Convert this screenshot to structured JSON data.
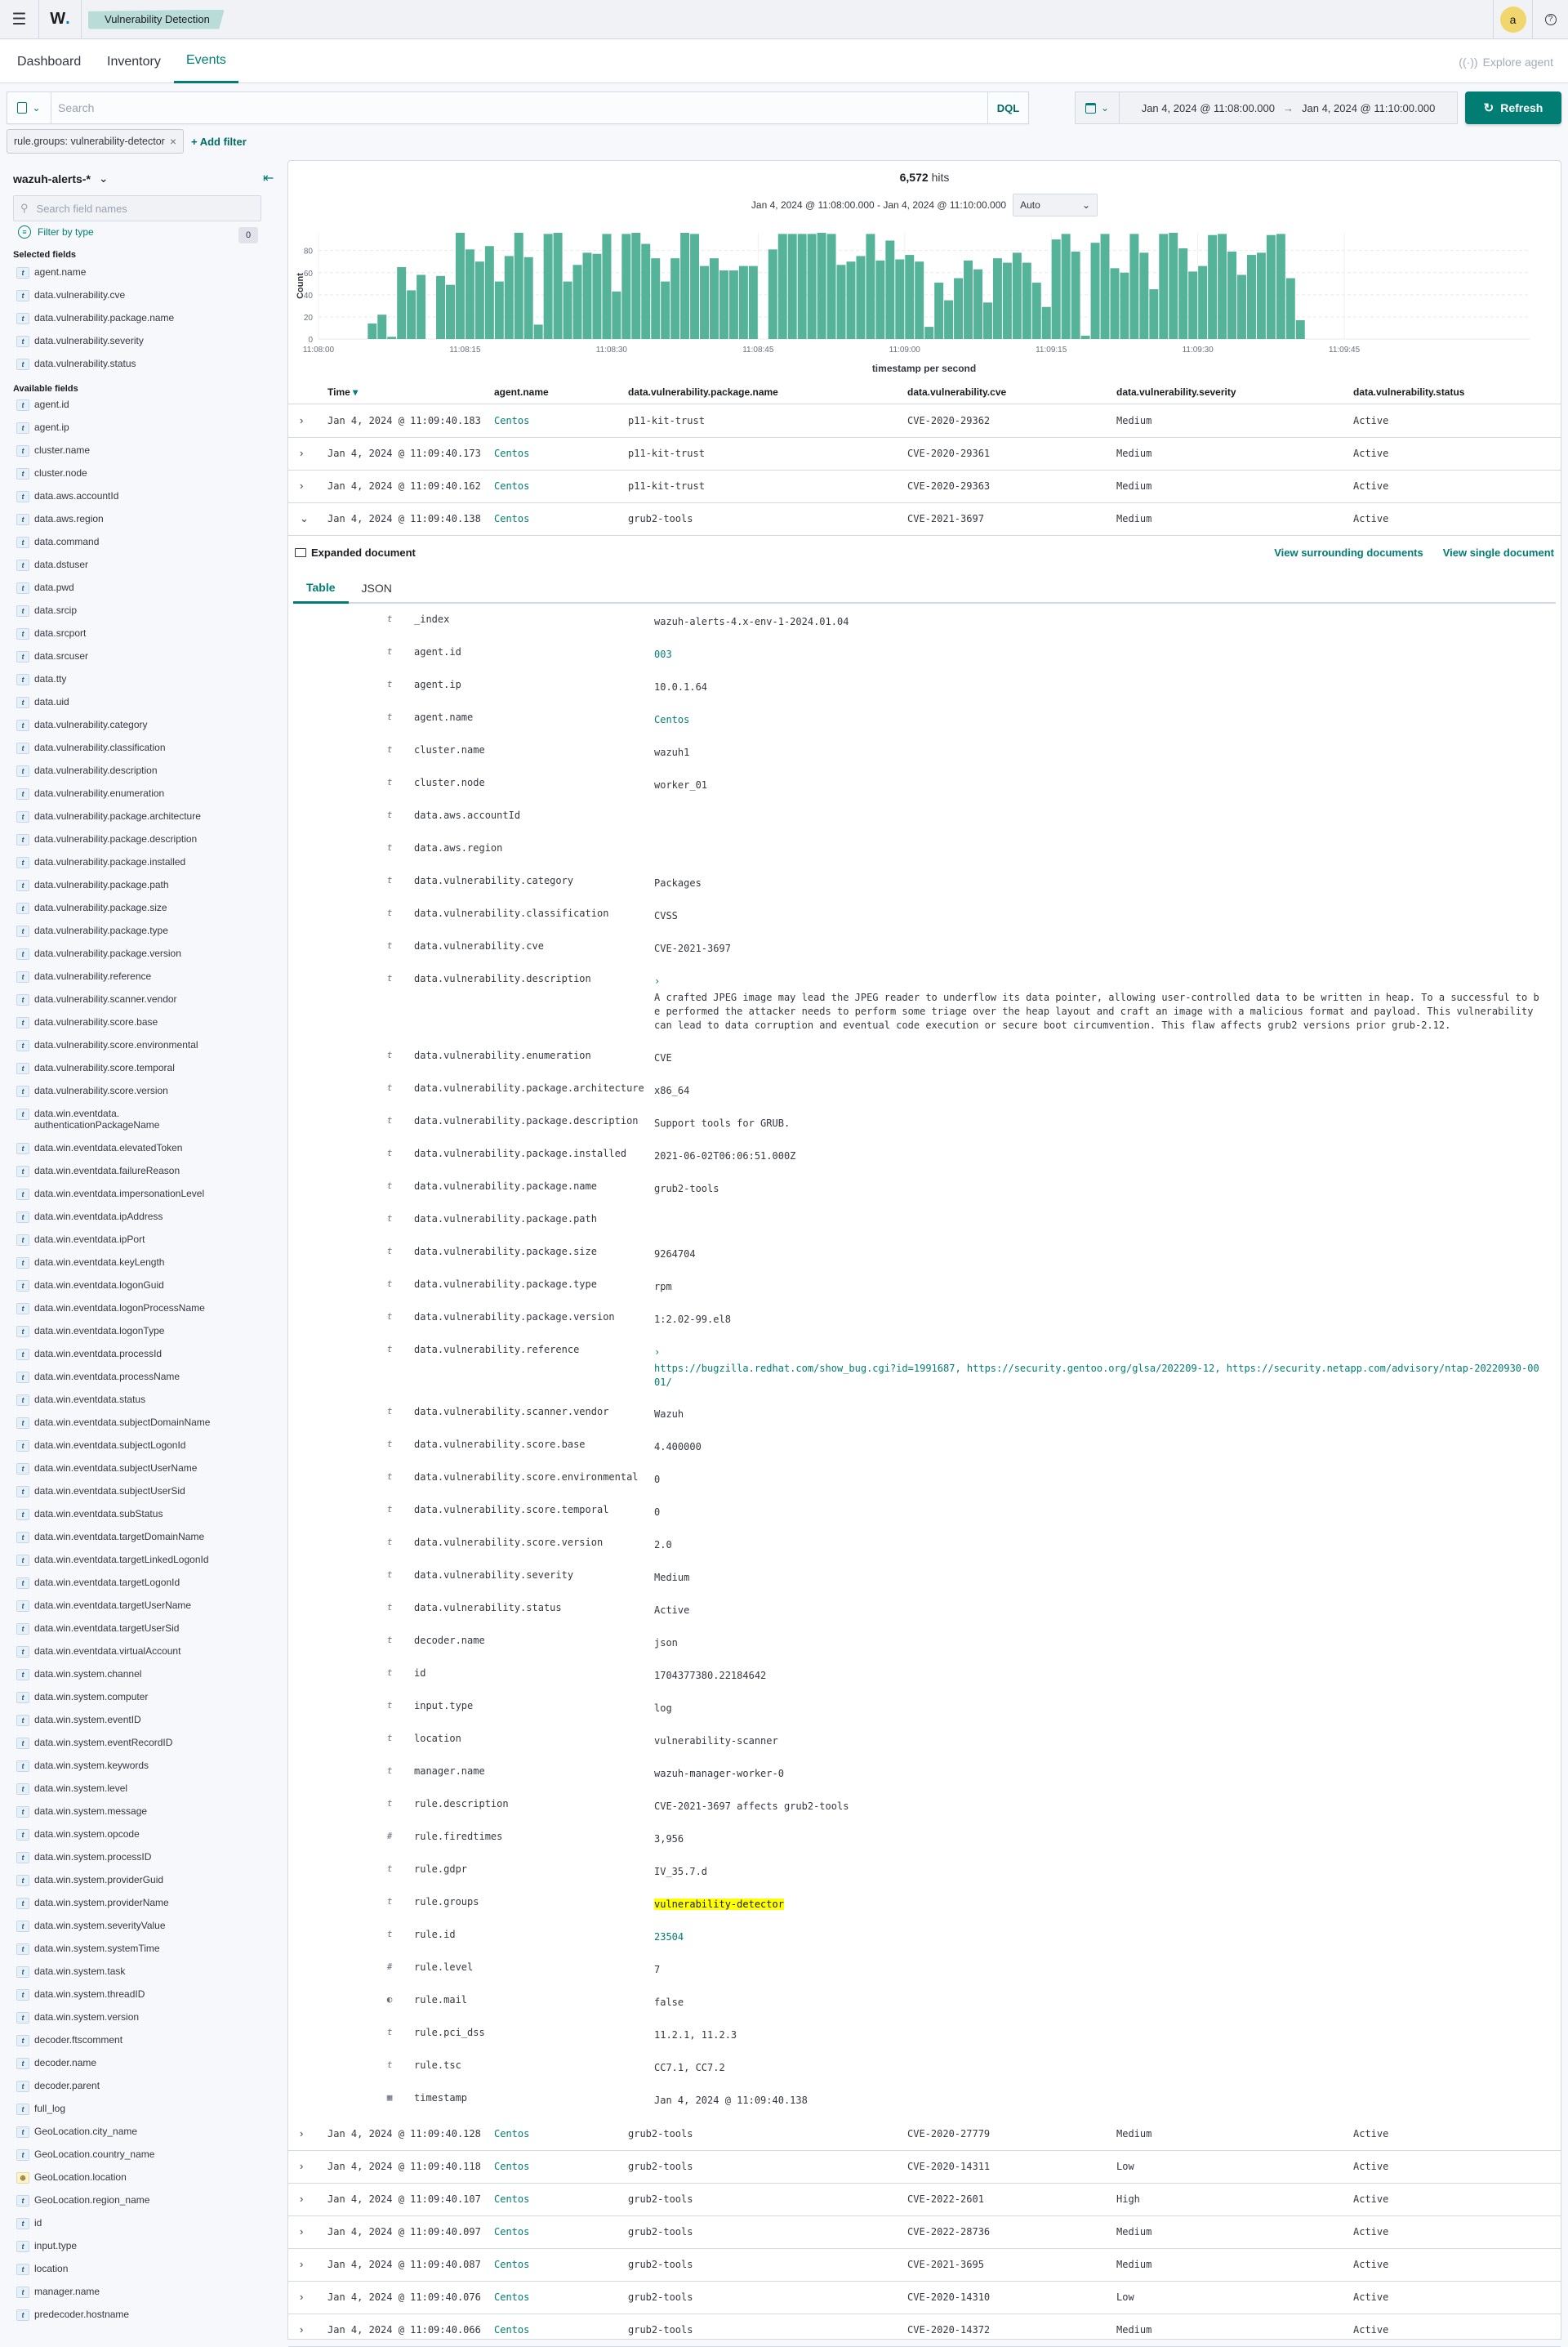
{
  "header": {
    "menu_icon": "hamburger-menu-icon",
    "logo_text": "W",
    "logo_dot": ".",
    "breadcrumb": "Vulnerability Detection",
    "avatar_initial": "a",
    "help_icon": "?"
  },
  "nav": {
    "tabs": [
      {
        "label": "Dashboard",
        "active": false
      },
      {
        "label": "Inventory",
        "active": false
      },
      {
        "label": "Events",
        "active": true
      }
    ],
    "explore_agent": "Explore agent"
  },
  "query": {
    "search_placeholder": "Search",
    "search_value": "",
    "language": "DQL",
    "date_start": "Jan 4, 2024 @ 11:08:00.000",
    "date_arrow": "→",
    "date_end": "Jan 4, 2024 @ 11:10:00.000",
    "refresh_label": "Refresh"
  },
  "filters": {
    "pills": [
      {
        "label": "rule.groups: vulnerability-detector",
        "remove": "×"
      }
    ],
    "add_filter_label": "+ Add filter"
  },
  "sidebar": {
    "index_pattern": "wazuh-alerts-*",
    "search_placeholder": "Search field names",
    "filter_by_type": "Filter by type",
    "filter_count": "0",
    "selected_header": "Selected fields",
    "selected_fields": [
      {
        "type": "t",
        "name": "agent.name"
      },
      {
        "type": "t",
        "name": "data.vulnerability.cve"
      },
      {
        "type": "t",
        "name": "data.vulnerability.package.name"
      },
      {
        "type": "t",
        "name": "data.vulnerability.severity"
      },
      {
        "type": "t",
        "name": "data.vulnerability.status"
      }
    ],
    "available_header": "Available fields",
    "available_fields": [
      {
        "type": "t",
        "name": "agent.id"
      },
      {
        "type": "t",
        "name": "agent.ip"
      },
      {
        "type": "t",
        "name": "cluster.name"
      },
      {
        "type": "t",
        "name": "cluster.node"
      },
      {
        "type": "t",
        "name": "data.aws.accountId"
      },
      {
        "type": "t",
        "name": "data.aws.region"
      },
      {
        "type": "t",
        "name": "data.command"
      },
      {
        "type": "t",
        "name": "data.dstuser"
      },
      {
        "type": "t",
        "name": "data.pwd"
      },
      {
        "type": "t",
        "name": "data.srcip"
      },
      {
        "type": "t",
        "name": "data.srcport"
      },
      {
        "type": "t",
        "name": "data.srcuser"
      },
      {
        "type": "t",
        "name": "data.tty"
      },
      {
        "type": "t",
        "name": "data.uid"
      },
      {
        "type": "t",
        "name": "data.vulnerability.category"
      },
      {
        "type": "t",
        "name": "data.vulnerability.classification"
      },
      {
        "type": "t",
        "name": "data.vulnerability.description"
      },
      {
        "type": "t",
        "name": "data.vulnerability.enumeration"
      },
      {
        "type": "t",
        "name": "data.vulnerability.package.architecture"
      },
      {
        "type": "t",
        "name": "data.vulnerability.package.description"
      },
      {
        "type": "t",
        "name": "data.vulnerability.package.installed"
      },
      {
        "type": "t",
        "name": "data.vulnerability.package.path"
      },
      {
        "type": "t",
        "name": "data.vulnerability.package.size"
      },
      {
        "type": "t",
        "name": "data.vulnerability.package.type"
      },
      {
        "type": "t",
        "name": "data.vulnerability.package.version"
      },
      {
        "type": "t",
        "name": "data.vulnerability.reference"
      },
      {
        "type": "t",
        "name": "data.vulnerability.scanner.vendor"
      },
      {
        "type": "t",
        "name": "data.vulnerability.score.base"
      },
      {
        "type": "t",
        "name": "data.vulnerability.score.environmental"
      },
      {
        "type": "t",
        "name": "data.vulnerability.score.temporal"
      },
      {
        "type": "t",
        "name": "data.vulnerability.score.version"
      },
      {
        "type": "t",
        "name": "data.win.eventdata.\nauthenticationPackageName"
      },
      {
        "type": "t",
        "name": "data.win.eventdata.elevatedToken"
      },
      {
        "type": "t",
        "name": "data.win.eventdata.failureReason"
      },
      {
        "type": "t",
        "name": "data.win.eventdata.impersonationLevel"
      },
      {
        "type": "t",
        "name": "data.win.eventdata.ipAddress"
      },
      {
        "type": "t",
        "name": "data.win.eventdata.ipPort"
      },
      {
        "type": "t",
        "name": "data.win.eventdata.keyLength"
      },
      {
        "type": "t",
        "name": "data.win.eventdata.logonGuid"
      },
      {
        "type": "t",
        "name": "data.win.eventdata.logonProcessName"
      },
      {
        "type": "t",
        "name": "data.win.eventdata.logonType"
      },
      {
        "type": "t",
        "name": "data.win.eventdata.processId"
      },
      {
        "type": "t",
        "name": "data.win.eventdata.processName"
      },
      {
        "type": "t",
        "name": "data.win.eventdata.status"
      },
      {
        "type": "t",
        "name": "data.win.eventdata.subjectDomainName"
      },
      {
        "type": "t",
        "name": "data.win.eventdata.subjectLogonId"
      },
      {
        "type": "t",
        "name": "data.win.eventdata.subjectUserName"
      },
      {
        "type": "t",
        "name": "data.win.eventdata.subjectUserSid"
      },
      {
        "type": "t",
        "name": "data.win.eventdata.subStatus"
      },
      {
        "type": "t",
        "name": "data.win.eventdata.targetDomainName"
      },
      {
        "type": "t",
        "name": "data.win.eventdata.targetLinkedLogonId"
      },
      {
        "type": "t",
        "name": "data.win.eventdata.targetLogonId"
      },
      {
        "type": "t",
        "name": "data.win.eventdata.targetUserName"
      },
      {
        "type": "t",
        "name": "data.win.eventdata.targetUserSid"
      },
      {
        "type": "t",
        "name": "data.win.eventdata.virtualAccount"
      },
      {
        "type": "t",
        "name": "data.win.system.channel"
      },
      {
        "type": "t",
        "name": "data.win.system.computer"
      },
      {
        "type": "t",
        "name": "data.win.system.eventID"
      },
      {
        "type": "t",
        "name": "data.win.system.eventRecordID"
      },
      {
        "type": "t",
        "name": "data.win.system.keywords"
      },
      {
        "type": "t",
        "name": "data.win.system.level"
      },
      {
        "type": "t",
        "name": "data.win.system.message"
      },
      {
        "type": "t",
        "name": "data.win.system.opcode"
      },
      {
        "type": "t",
        "name": "data.win.system.processID"
      },
      {
        "type": "t",
        "name": "data.win.system.providerGuid"
      },
      {
        "type": "t",
        "name": "data.win.system.providerName"
      },
      {
        "type": "t",
        "name": "data.win.system.severityValue"
      },
      {
        "type": "t",
        "name": "data.win.system.systemTime"
      },
      {
        "type": "t",
        "name": "data.win.system.task"
      },
      {
        "type": "t",
        "name": "data.win.system.threadID"
      },
      {
        "type": "t",
        "name": "data.win.system.version"
      },
      {
        "type": "t",
        "name": "decoder.ftscomment"
      },
      {
        "type": "t",
        "name": "decoder.name"
      },
      {
        "type": "t",
        "name": "decoder.parent"
      },
      {
        "type": "t",
        "name": "full_log"
      },
      {
        "type": "t",
        "name": "GeoLocation.city_name"
      },
      {
        "type": "t",
        "name": "GeoLocation.country_name"
      },
      {
        "type": "geo",
        "name": "GeoLocation.location"
      },
      {
        "type": "t",
        "name": "GeoLocation.region_name"
      },
      {
        "type": "t",
        "name": "id"
      },
      {
        "type": "t",
        "name": "input.type"
      },
      {
        "type": "t",
        "name": "location"
      },
      {
        "type": "t",
        "name": "manager.name"
      },
      {
        "type": "t",
        "name": "predecoder.hostname"
      }
    ]
  },
  "histogram": {
    "hits_count": "6,572",
    "hits_label": "hits",
    "range_text": "Jan 4, 2024 @ 11:08:00.000 - Jan 4, 2024 @ 11:10:00.000",
    "interval": "Auto"
  },
  "chart_data": {
    "type": "bar",
    "title": "",
    "xlabel": "timestamp per second",
    "ylabel": "Count",
    "ylim": [
      0,
      96
    ],
    "yticks": [
      0,
      20,
      40,
      60,
      80
    ],
    "xticks": [
      "11:08:00",
      "11:08:15",
      "11:08:30",
      "11:08:45",
      "11:09:00",
      "11:09:15",
      "11:09:30",
      "11:09:45"
    ],
    "xrange_seconds": [
      0,
      120
    ],
    "grid": true,
    "color": "#54b399",
    "x_start": "11:08:00",
    "bucket": "1s",
    "values": [
      0,
      0,
      0,
      0,
      0,
      14,
      22,
      2,
      65,
      44,
      58,
      0,
      57,
      49,
      96,
      81,
      70,
      84,
      52,
      75,
      96,
      74,
      13,
      95,
      96,
      52,
      67,
      78,
      77,
      95,
      43,
      95,
      96,
      86,
      73,
      52,
      73,
      96,
      95,
      66,
      73,
      62,
      62,
      66,
      66,
      0,
      81,
      95,
      95,
      95,
      95,
      96,
      95,
      67,
      70,
      75,
      95,
      71,
      89,
      72,
      76,
      70,
      11,
      51,
      35,
      55,
      71,
      63,
      33,
      73,
      69,
      78,
      69,
      51,
      29,
      90,
      95,
      79,
      3,
      87,
      95,
      64,
      60,
      95,
      78,
      45,
      95,
      96,
      82,
      61,
      66,
      94,
      95,
      79,
      58,
      76,
      78,
      94,
      95,
      55,
      17
    ]
  },
  "table": {
    "columns": [
      "Time",
      "agent.name",
      "data.vulnerability.package.name",
      "data.vulnerability.cve",
      "data.vulnerability.severity",
      "data.vulnerability.status"
    ],
    "sort_icon": "▾",
    "rows_top": [
      {
        "time": "Jan 4, 2024 @ 11:09:40.183",
        "agent": "Centos",
        "package": "p11-kit-trust",
        "cve": "CVE-2020-29362",
        "severity": "Medium",
        "status": "Active"
      },
      {
        "time": "Jan 4, 2024 @ 11:09:40.173",
        "agent": "Centos",
        "package": "p11-kit-trust",
        "cve": "CVE-2020-29361",
        "severity": "Medium",
        "status": "Active"
      },
      {
        "time": "Jan 4, 2024 @ 11:09:40.162",
        "agent": "Centos",
        "package": "p11-kit-trust",
        "cve": "CVE-2020-29363",
        "severity": "Medium",
        "status": "Active"
      },
      {
        "time": "Jan 4, 2024 @ 11:09:40.138",
        "agent": "Centos",
        "package": "grub2-tools",
        "cve": "CVE-2021-3697",
        "severity": "Medium",
        "status": "Active"
      }
    ],
    "rows_bottom": [
      {
        "time": "Jan 4, 2024 @ 11:09:40.128",
        "agent": "Centos",
        "package": "grub2-tools",
        "cve": "CVE-2020-27779",
        "severity": "Medium",
        "status": "Active"
      },
      {
        "time": "Jan 4, 2024 @ 11:09:40.118",
        "agent": "Centos",
        "package": "grub2-tools",
        "cve": "CVE-2020-14311",
        "severity": "Low",
        "status": "Active"
      },
      {
        "time": "Jan 4, 2024 @ 11:09:40.107",
        "agent": "Centos",
        "package": "grub2-tools",
        "cve": "CVE-2022-2601",
        "severity": "High",
        "status": "Active"
      },
      {
        "time": "Jan 4, 2024 @ 11:09:40.097",
        "agent": "Centos",
        "package": "grub2-tools",
        "cve": "CVE-2022-28736",
        "severity": "Medium",
        "status": "Active"
      },
      {
        "time": "Jan 4, 2024 @ 11:09:40.087",
        "agent": "Centos",
        "package": "grub2-tools",
        "cve": "CVE-2021-3695",
        "severity": "Medium",
        "status": "Active"
      },
      {
        "time": "Jan 4, 2024 @ 11:09:40.076",
        "agent": "Centos",
        "package": "grub2-tools",
        "cve": "CVE-2020-14310",
        "severity": "Low",
        "status": "Active"
      },
      {
        "time": "Jan 4, 2024 @ 11:09:40.066",
        "agent": "Centos",
        "package": "grub2-tools",
        "cve": "CVE-2020-14372",
        "severity": "Medium",
        "status": "Active"
      }
    ]
  },
  "expanded": {
    "title": "Expanded document",
    "view_surrounding": "View surrounding documents",
    "view_single": "View single document",
    "tabs": [
      {
        "label": "Table",
        "active": true
      },
      {
        "label": "JSON",
        "active": false
      }
    ],
    "fields": [
      {
        "type": "t",
        "key": "_index",
        "value": "wazuh-alerts-4.x-env-1-2024.01.04"
      },
      {
        "type": "t",
        "key": "agent.id",
        "value": "003",
        "link": true
      },
      {
        "type": "t",
        "key": "agent.ip",
        "value": "10.0.1.64"
      },
      {
        "type": "t",
        "key": "agent.name",
        "value": "Centos",
        "link": true
      },
      {
        "type": "t",
        "key": "cluster.name",
        "value": "wazuh1"
      },
      {
        "type": "t",
        "key": "cluster.node",
        "value": "worker_01"
      },
      {
        "type": "t",
        "key": "data.aws.accountId",
        "value": ""
      },
      {
        "type": "t",
        "key": "data.aws.region",
        "value": ""
      },
      {
        "type": "t",
        "key": "data.vulnerability.category",
        "value": "Packages"
      },
      {
        "type": "t",
        "key": "data.vulnerability.classification",
        "value": "CVSS"
      },
      {
        "type": "t",
        "key": "data.vulnerability.cve",
        "value": "CVE-2021-3697"
      },
      {
        "type": "t",
        "key": "data.vulnerability.description",
        "expandable": true,
        "value": "A crafted JPEG image may lead the JPEG reader to underflow its data pointer, allowing user-controlled data to be written in heap. To a successful to be performed the attacker needs to perform some triage over the heap layout and craft an image with a malicious format and payload. This vulnerability can lead to data corruption and eventual code execution or secure boot circumvention. This flaw affects grub2 versions prior grub-2.12."
      },
      {
        "type": "t",
        "key": "data.vulnerability.enumeration",
        "value": "CVE"
      },
      {
        "type": "t",
        "key": "data.vulnerability.package.architecture",
        "value": "x86_64"
      },
      {
        "type": "t",
        "key": "data.vulnerability.package.description",
        "value": "Support tools for GRUB."
      },
      {
        "type": "t",
        "key": "data.vulnerability.package.installed",
        "value": "2021-06-02T06:06:51.000Z"
      },
      {
        "type": "t",
        "key": "data.vulnerability.package.name",
        "value": "grub2-tools"
      },
      {
        "type": "t",
        "key": "data.vulnerability.package.path",
        "value": ""
      },
      {
        "type": "t",
        "key": "data.vulnerability.package.size",
        "value": "9264704"
      },
      {
        "type": "t",
        "key": "data.vulnerability.package.type",
        "value": "rpm"
      },
      {
        "type": "t",
        "key": "data.vulnerability.package.version",
        "value": "1:2.02-99.el8"
      },
      {
        "type": "t",
        "key": "data.vulnerability.reference",
        "expandable": true,
        "link": true,
        "value": "https://bugzilla.redhat.com/show_bug.cgi?id=1991687, https://security.gentoo.org/glsa/202209-12, https://security.netapp.com/advisory/ntap-20220930-0001/"
      },
      {
        "type": "t",
        "key": "data.vulnerability.scanner.vendor",
        "value": "Wazuh"
      },
      {
        "type": "t",
        "key": "data.vulnerability.score.base",
        "value": "4.400000"
      },
      {
        "type": "t",
        "key": "data.vulnerability.score.environmental",
        "value": "0"
      },
      {
        "type": "t",
        "key": "data.vulnerability.score.temporal",
        "value": "0"
      },
      {
        "type": "t",
        "key": "data.vulnerability.score.version",
        "value": "2.0"
      },
      {
        "type": "t",
        "key": "data.vulnerability.severity",
        "value": "Medium"
      },
      {
        "type": "t",
        "key": "data.vulnerability.status",
        "value": "Active"
      },
      {
        "type": "t",
        "key": "decoder.name",
        "value": "json"
      },
      {
        "type": "t",
        "key": "id",
        "value": "1704377380.22184642"
      },
      {
        "type": "t",
        "key": "input.type",
        "value": "log"
      },
      {
        "type": "t",
        "key": "location",
        "value": "vulnerability-scanner"
      },
      {
        "type": "t",
        "key": "manager.name",
        "value": "wazuh-manager-worker-0"
      },
      {
        "type": "t",
        "key": "rule.description",
        "value": "CVE-2021-3697 affects grub2-tools"
      },
      {
        "type": "#",
        "key": "rule.firedtimes",
        "value": "3,956"
      },
      {
        "type": "t",
        "key": "rule.gdpr",
        "value": "IV_35.7.d"
      },
      {
        "type": "t",
        "key": "rule.groups",
        "value": "vulnerability-detector",
        "highlight": true
      },
      {
        "type": "t",
        "key": "rule.id",
        "value": "23504",
        "link": true
      },
      {
        "type": "#",
        "key": "rule.level",
        "value": "7"
      },
      {
        "type": "bool",
        "key": "rule.mail",
        "value": "false"
      },
      {
        "type": "t",
        "key": "rule.pci_dss",
        "value": "11.2.1, 11.2.3"
      },
      {
        "type": "t",
        "key": "rule.tsc",
        "value": "CC7.1, CC7.2"
      },
      {
        "type": "date",
        "key": "timestamp",
        "value": "Jan 4, 2024 @ 11:09:40.138"
      }
    ]
  }
}
